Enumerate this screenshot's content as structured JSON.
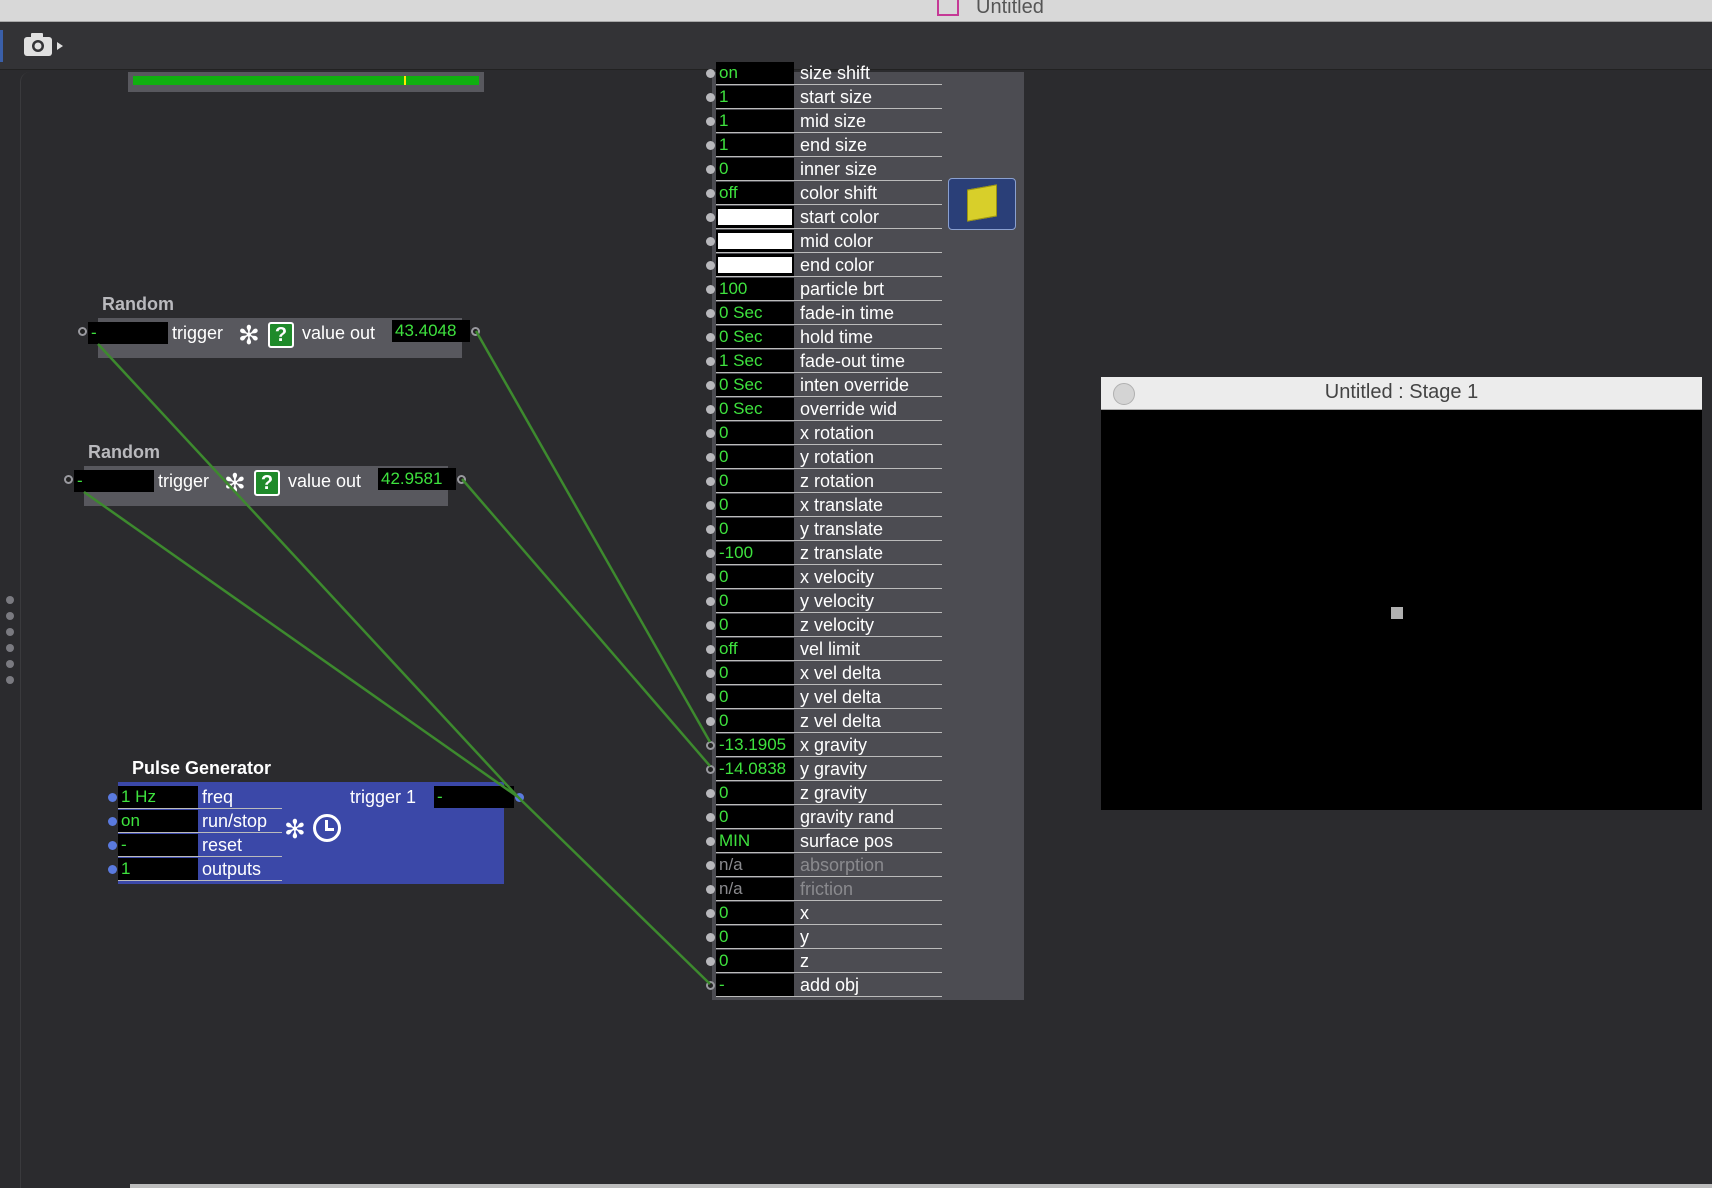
{
  "window": {
    "title": "Untitled"
  },
  "toolbar": {
    "camera_icon": "camera-icon",
    "menu_arrow": "▸"
  },
  "actor": {
    "rows": [
      {
        "value": "on",
        "label": "size shift",
        "kind": "text"
      },
      {
        "value": "1",
        "label": "start size",
        "kind": "text"
      },
      {
        "value": "1",
        "label": "mid size",
        "kind": "text"
      },
      {
        "value": "1",
        "label": "end size",
        "kind": "text"
      },
      {
        "value": "0",
        "label": "inner size",
        "kind": "text"
      },
      {
        "value": "off",
        "label": "color shift",
        "kind": "text"
      },
      {
        "value": "",
        "label": "start color",
        "kind": "color",
        "color": "#ffffff"
      },
      {
        "value": "",
        "label": "mid color",
        "kind": "color",
        "color": "#ffffff"
      },
      {
        "value": "",
        "label": "end color",
        "kind": "color",
        "color": "#ffffff"
      },
      {
        "value": "100",
        "label": "particle brt",
        "kind": "text"
      },
      {
        "value": "0 Sec",
        "label": "fade-in time",
        "kind": "text"
      },
      {
        "value": "0 Sec",
        "label": "hold time",
        "kind": "text"
      },
      {
        "value": "1 Sec",
        "label": "fade-out time",
        "kind": "text"
      },
      {
        "value": "0 Sec",
        "label": "inten override",
        "kind": "text"
      },
      {
        "value": "0 Sec",
        "label": "override wid",
        "kind": "text"
      },
      {
        "value": "0",
        "label": "x rotation",
        "kind": "text"
      },
      {
        "value": "0",
        "label": "y rotation",
        "kind": "text"
      },
      {
        "value": "0",
        "label": "z rotation",
        "kind": "text"
      },
      {
        "value": "0",
        "label": "x translate",
        "kind": "text"
      },
      {
        "value": "0",
        "label": "y translate",
        "kind": "text"
      },
      {
        "value": "-100",
        "label": "z translate",
        "kind": "text"
      },
      {
        "value": "0",
        "label": "x velocity",
        "kind": "text"
      },
      {
        "value": "0",
        "label": "y velocity",
        "kind": "text"
      },
      {
        "value": "0",
        "label": "z velocity",
        "kind": "text"
      },
      {
        "value": "off",
        "label": "vel limit",
        "kind": "text"
      },
      {
        "value": "0",
        "label": "x vel delta",
        "kind": "text"
      },
      {
        "value": "0",
        "label": "y vel delta",
        "kind": "text"
      },
      {
        "value": "0",
        "label": "z vel delta",
        "kind": "text"
      },
      {
        "value": "-13.1905",
        "label": "x gravity",
        "kind": "text",
        "connected": true
      },
      {
        "value": "-14.0838",
        "label": "y gravity",
        "kind": "text",
        "connected": true
      },
      {
        "value": "0",
        "label": "z gravity",
        "kind": "text"
      },
      {
        "value": "0",
        "label": "gravity rand",
        "kind": "text"
      },
      {
        "value": "MIN",
        "label": "surface pos",
        "kind": "text"
      },
      {
        "value": "n/a",
        "label": "absorption",
        "kind": "text",
        "disabled": true
      },
      {
        "value": "n/a",
        "label": "friction",
        "kind": "text",
        "disabled": true
      },
      {
        "value": "0",
        "label": "x",
        "kind": "text"
      },
      {
        "value": "0",
        "label": "y",
        "kind": "text"
      },
      {
        "value": "0",
        "label": "z",
        "kind": "text"
      },
      {
        "value": "-",
        "label": "add obj",
        "kind": "text",
        "connected": true
      }
    ]
  },
  "random1": {
    "title": "Random",
    "trigger_value": "-",
    "trigger_label": "trigger",
    "help": "?",
    "out_label": "value out",
    "out_value": "43.4048"
  },
  "random2": {
    "title": "Random",
    "trigger_value": "-",
    "trigger_label": "trigger",
    "help": "?",
    "out_label": "value out",
    "out_value": "42.9581"
  },
  "pulse": {
    "title": "Pulse Generator",
    "inputs": [
      {
        "value": "1 Hz",
        "label": "freq"
      },
      {
        "value": "on",
        "label": "run/stop"
      },
      {
        "value": "-",
        "label": "reset"
      },
      {
        "value": "1",
        "label": "outputs"
      }
    ],
    "out_label": "trigger 1",
    "out_value": "-"
  },
  "stage": {
    "title": "Untitled : Stage 1"
  },
  "colors": {
    "wire": "#3d8a2e",
    "value_text": "#3ee23e",
    "pulse_bg": "#3b48a8"
  }
}
